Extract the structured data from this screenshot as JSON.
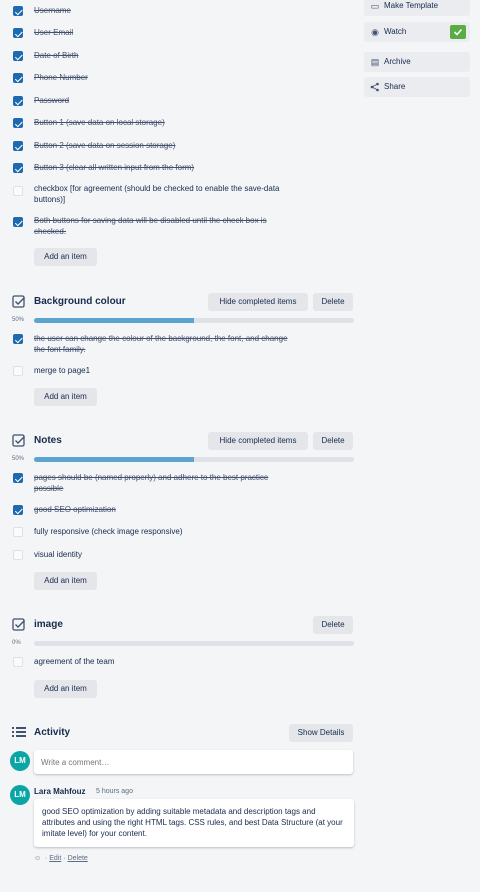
{
  "sidebar": {
    "make_template": "Make Template",
    "watch": "Watch",
    "archive": "Archive",
    "share": "Share",
    "watch_check_color": "#5aac44"
  },
  "checklist1": {
    "items": [
      {
        "text": "Username",
        "done": true
      },
      {
        "text": "User Email",
        "done": true
      },
      {
        "text": "Date of Birth",
        "done": true
      },
      {
        "text": "Phone Number",
        "done": true
      },
      {
        "text": "Password",
        "done": true
      },
      {
        "text": "Button 1 (save data on local storage)",
        "done": true
      },
      {
        "text": "Button 2 (save data on session storage)",
        "done": true
      },
      {
        "text": "Button 3 (clear all written input from the form)",
        "done": true
      },
      {
        "text": "checkbox [for agreement (should be checked to enable the save-data buttons)]",
        "done": false
      },
      {
        "text": "Both buttons for saving data will be disabled until the check box is checked.",
        "done": true
      }
    ],
    "add_item": "Add an item"
  },
  "checklist2": {
    "title": "Background colour",
    "hide_completed": "Hide completed items",
    "delete": "Delete",
    "percent": "50%",
    "progress": 0.5,
    "items": [
      {
        "text": "the user can change the colour of the background, the font, and change the font family.",
        "done": true
      },
      {
        "text": "merge to page1",
        "done": false
      }
    ],
    "add_item": "Add an item"
  },
  "checklist3": {
    "title": "Notes",
    "hide_completed": "Hide completed items",
    "delete": "Delete",
    "percent": "50%",
    "progress": 0.5,
    "items": [
      {
        "text": "pages should be (named properly) and adhere to the best practice possible",
        "done": true
      },
      {
        "text": "good SEO optimization",
        "done": true
      },
      {
        "text": "fully responsive (check image responsive)",
        "done": false
      },
      {
        "text": "visual identity",
        "done": false
      }
    ],
    "add_item": "Add an item"
  },
  "checklist4": {
    "title": "image",
    "delete": "Delete",
    "percent": "0%",
    "progress": 0,
    "items": [
      {
        "text": "agreement of the team",
        "done": false
      }
    ],
    "add_item": "Add an item"
  },
  "activity": {
    "title": "Activity",
    "show_details": "Show Details",
    "comment_placeholder": "Write a comment…",
    "avatar_initials": "LM",
    "comment": {
      "author": "Lara Mahfouz",
      "time": "5 hours ago",
      "text": "good SEO optimization by adding suitable metadata and description tags and attributes and using the right HTML tags. CSS rules, and best Data Structure (at your imitate level) for your content.",
      "edit": "Edit",
      "delete": "Delete",
      "separator": "·"
    }
  }
}
